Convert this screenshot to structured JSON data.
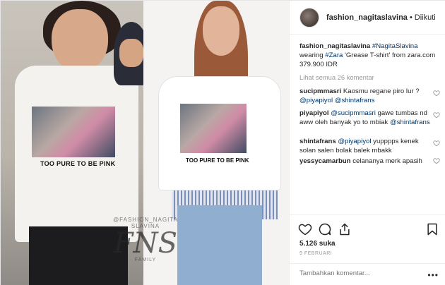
{
  "header": {
    "username": "fashion_nagitaslavina",
    "separator": "•",
    "follow_status": "Diikuti"
  },
  "caption": {
    "username": "fashion_nagitaslavina",
    "hashtag": "#NagitaSlavina",
    "text_1": "wearing",
    "hashtag_2": "#Zara",
    "text_2": "'Grease T-shirt' from zara.com 379.900 IDR"
  },
  "view_all_comments": "Lihat semua 26 komentar",
  "comments": [
    {
      "username": "sucipmmasri",
      "text": "Kaosmu regane piro lur ?",
      "mentions": "@piyapiyol @shintafrans"
    },
    {
      "username": "piyapiyol",
      "mention_lead": "@sucipmmasri",
      "text": "gawe tumbas nd aww oleh banyak yo to mbiak",
      "mentions": "@shintafrans"
    },
    {
      "username": "shintafrans",
      "mention_lead": "@piyapiyol",
      "text": "yupppps kenek solan salen bolak balek mbakk"
    },
    {
      "username": "yessycamarbun",
      "text": "celananya merk apasih"
    }
  ],
  "actions": {
    "like_icon": "heart-icon",
    "comment_icon": "comment-bubble-icon",
    "share_icon": "share-icon",
    "save_icon": "bookmark-icon"
  },
  "likes": "5.126 suka",
  "date": "9 FEBRUARI",
  "add_comment_placeholder": "Tambahkan komentar...",
  "more_options": "•••",
  "photo": {
    "print_text_left": "TOO PURE TO BE PINK",
    "print_text_right": "TOO PURE TO BE PINK",
    "watermark_top": "@FASHION_NAGITA SLAVINA",
    "watermark_mono": "FNS",
    "watermark_bottom": "FAMILY"
  }
}
